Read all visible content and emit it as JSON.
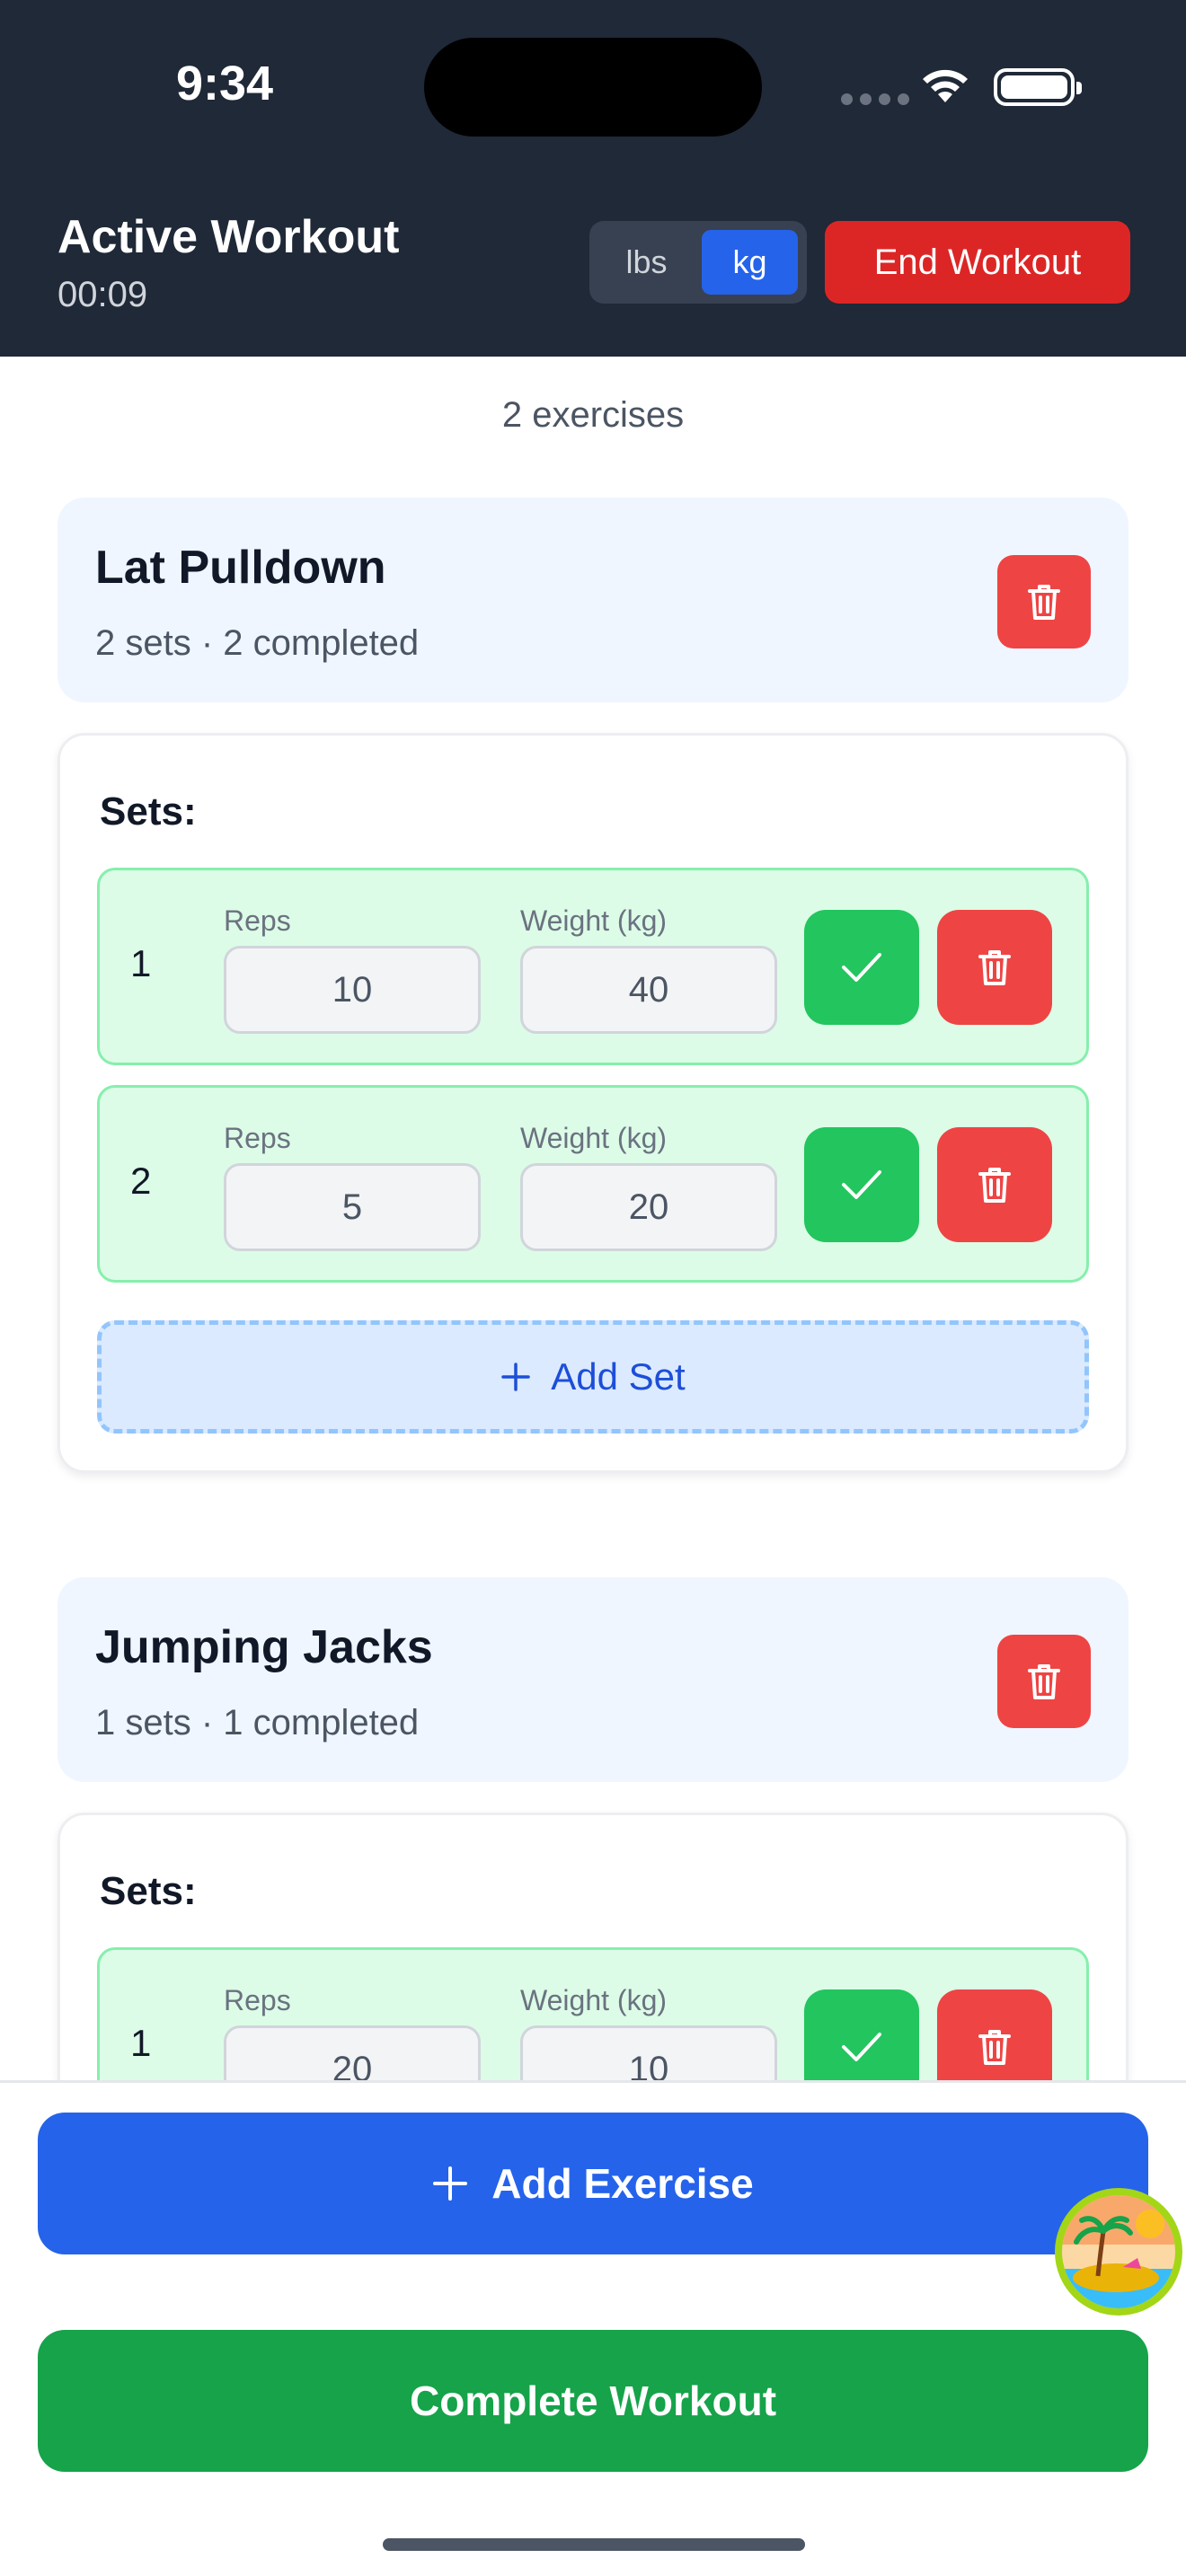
{
  "status_bar": {
    "time": "9:34"
  },
  "header": {
    "title": "Active Workout",
    "elapsed": "00:09",
    "unit_lbs": "lbs",
    "unit_kg": "kg",
    "selected_unit": "kg",
    "end_button": "End Workout"
  },
  "exercise_count": "2 exercises",
  "sets_label": "Sets:",
  "field_labels": {
    "reps": "Reps",
    "weight": "Weight (kg)"
  },
  "exercises": [
    {
      "name": "Lat Pulldown",
      "summary": "2 sets · 2 completed",
      "sets": [
        {
          "number": "1",
          "reps": "10",
          "weight": "40",
          "completed": true
        },
        {
          "number": "2",
          "reps": "5",
          "weight": "20",
          "completed": true
        }
      ],
      "add_set": "Add Set"
    },
    {
      "name": "Jumping Jacks",
      "summary": "1 sets · 1 completed",
      "sets": [
        {
          "number": "1",
          "reps": "20",
          "weight": "10",
          "completed": true
        }
      ]
    }
  ],
  "actions": {
    "add_exercise": "Add Exercise",
    "complete_workout": "Complete Workout"
  },
  "colors": {
    "header_bg": "#1f2937",
    "accent_blue": "#2563eb",
    "danger_red": "#ef4444",
    "success_green": "#22c55e",
    "complete_green": "#16a34a"
  },
  "icons": [
    "wifi-icon",
    "battery-icon",
    "trash-icon",
    "check-icon",
    "plus-icon",
    "avatar-beach-icon"
  ]
}
